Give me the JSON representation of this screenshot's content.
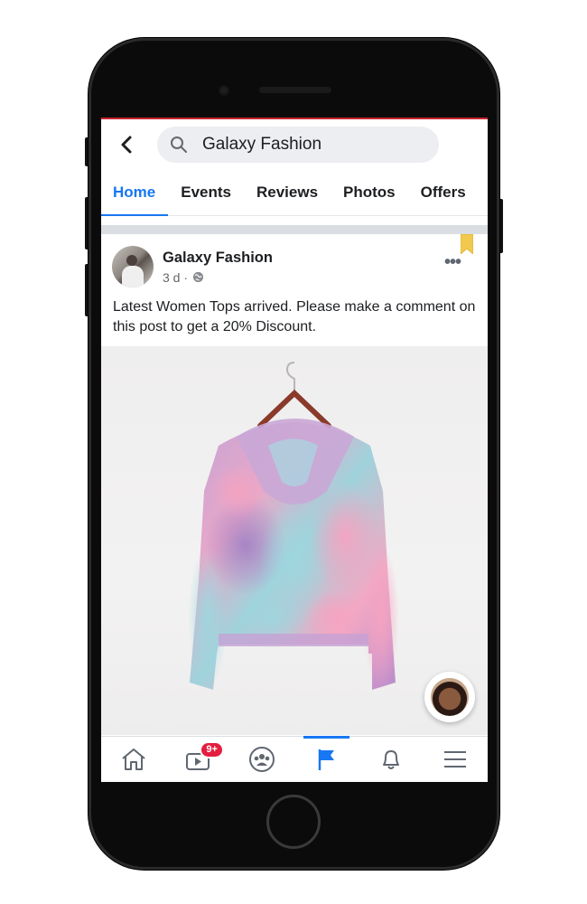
{
  "search": {
    "query": "Galaxy Fashion"
  },
  "tabs": [
    {
      "label": "Home",
      "active": true
    },
    {
      "label": "Events",
      "active": false
    },
    {
      "label": "Reviews",
      "active": false
    },
    {
      "label": "Photos",
      "active": false
    },
    {
      "label": "Offers",
      "active": false
    }
  ],
  "post": {
    "author": "Galaxy Fashion",
    "time": "3 d ·",
    "text": "Latest Women Tops arrived. Please make a comment on this post to get a 20% Discount."
  },
  "bottom_nav": {
    "items": [
      {
        "icon": "home-icon",
        "active": false
      },
      {
        "icon": "watch-video-icon",
        "badge": "9+",
        "active": false
      },
      {
        "icon": "groups-icon",
        "active": false
      },
      {
        "icon": "pages-flag-icon",
        "active": true
      },
      {
        "icon": "notifications-bell-icon",
        "active": false
      },
      {
        "icon": "menu-icon",
        "active": false
      }
    ]
  },
  "colors": {
    "accent": "#1877f2",
    "badge": "#e41e3f",
    "top_line": "#c8242f"
  }
}
